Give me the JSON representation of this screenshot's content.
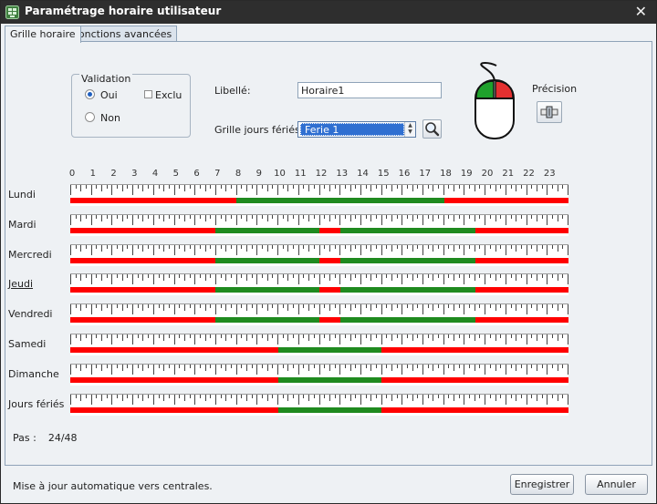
{
  "window": {
    "title": "Paramétrage horaire utilisateur",
    "close_glyph": "✕",
    "icon": "grid-app-icon"
  },
  "tabs": [
    {
      "label": "Grille horaire",
      "active": true
    },
    {
      "label": "Fonctions avancées",
      "active": false
    }
  ],
  "validation": {
    "legend": "Validation",
    "oui_label": "Oui",
    "oui_checked": true,
    "exclu_label": "Exclu",
    "exclu_checked": false,
    "non_label": "Non",
    "non_checked": false
  },
  "libelle": {
    "label": "Libellé:",
    "value": "Horaire1"
  },
  "holiday_grid": {
    "label": "Grille jours fériés:",
    "selected": "Ferie 1"
  },
  "precision": {
    "label": "Précision",
    "mouse_icon": "mouse-green-red-icon",
    "button_icon": "precision-slider-icon"
  },
  "colors": {
    "allowed": "#1f8a1f",
    "forbidden": "#ff0000",
    "mouse_left": "#1fa12c",
    "mouse_right": "#e53030"
  },
  "schedule": {
    "hours": [
      "0",
      "1",
      "2",
      "3",
      "4",
      "5",
      "6",
      "7",
      "8",
      "9",
      "10",
      "11",
      "12",
      "13",
      "14",
      "15",
      "16",
      "17",
      "18",
      "19",
      "20",
      "21",
      "22",
      "23"
    ],
    "day_start": 0,
    "day_end": 24,
    "days": [
      {
        "name": "Lundi",
        "link": false,
        "allowed": [
          [
            8,
            18
          ]
        ]
      },
      {
        "name": "Mardi",
        "link": false,
        "allowed": [
          [
            7,
            12
          ],
          [
            13,
            19.5
          ]
        ]
      },
      {
        "name": "Mercredi",
        "link": false,
        "allowed": [
          [
            7,
            12
          ],
          [
            13,
            19.5
          ]
        ]
      },
      {
        "name": "Jeudi",
        "link": true,
        "allowed": [
          [
            7,
            12
          ],
          [
            13,
            19.5
          ]
        ]
      },
      {
        "name": "Vendredi",
        "link": false,
        "allowed": [
          [
            7,
            12
          ],
          [
            13,
            19.5
          ]
        ]
      },
      {
        "name": "Samedi",
        "link": false,
        "allowed": [
          [
            10,
            15
          ]
        ]
      },
      {
        "name": "Dimanche",
        "link": false,
        "allowed": [
          [
            10,
            15
          ]
        ]
      },
      {
        "name": "Jours fériés",
        "link": false,
        "allowed": [
          [
            10,
            15
          ]
        ]
      }
    ]
  },
  "pas": {
    "label": "Pas :",
    "value": "24/48"
  },
  "footer": {
    "status": "Mise à jour automatique vers centrales.",
    "save_label": "Enregistrer",
    "cancel_label": "Annuler"
  }
}
